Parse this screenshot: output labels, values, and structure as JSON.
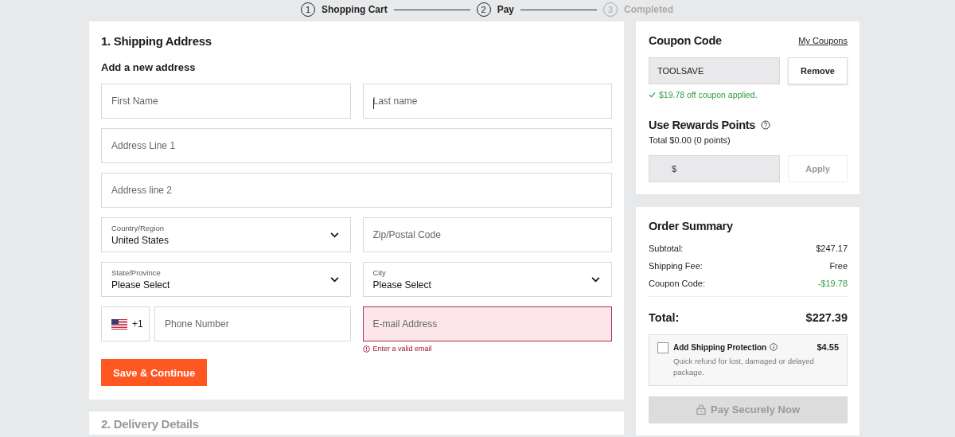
{
  "stepper": [
    {
      "number": "1",
      "label": "Shopping Cart",
      "active": true
    },
    {
      "number": "2",
      "label": "Pay",
      "active": true
    },
    {
      "number": "3",
      "label": "Completed",
      "active": false
    }
  ],
  "shipping": {
    "title": "1. Shipping Address",
    "subtitle": "Add a new address",
    "rows": [
      [
        {
          "kind": "text",
          "placeholder": "First Name",
          "error": false
        },
        {
          "kind": "text",
          "placeholder": "Last name",
          "error": false,
          "focused": true
        }
      ],
      [
        {
          "kind": "text",
          "placeholder": "Address Line 1",
          "error": false
        }
      ],
      [
        {
          "kind": "text",
          "placeholder": "Address line 2",
          "error": false
        }
      ],
      [
        {
          "kind": "select",
          "label": "Country/Region",
          "value": "United States"
        },
        {
          "kind": "text",
          "placeholder": "Zip/Postal Code",
          "error": false
        }
      ],
      [
        {
          "kind": "select",
          "label": "State/Province",
          "value": "Please Select"
        },
        {
          "kind": "select",
          "label": "City",
          "value": "Please Select"
        }
      ],
      [
        {
          "kind": "phone",
          "code": "+1",
          "placeholder": "Phone Number"
        },
        {
          "kind": "text",
          "placeholder": "E-mail Address",
          "error": true,
          "message": "Enter a valid email"
        }
      ]
    ],
    "button": "Save & Continue"
  },
  "next_section": {
    "title": "2. Delivery Details"
  },
  "coupon": {
    "title": "Coupon Code",
    "link": "My Coupons",
    "value": "TOOLSAVE",
    "button": "Remove",
    "message": "$19.78 off coupon applied."
  },
  "rewards": {
    "title": "Use Rewards Points",
    "total": "Total $0.00 (0 points)",
    "placeholder": "$",
    "button": "Apply",
    "disabled": true
  },
  "summary": {
    "title": "Order Summary",
    "lines": [
      {
        "label": "Subtotal:",
        "value": "$247.17",
        "discount": false
      },
      {
        "label": "Shipping Fee:",
        "value": "Free",
        "discount": false
      },
      {
        "label": "Coupon Code:",
        "value": "-$19.78",
        "discount": true
      }
    ],
    "total_label": "Total:",
    "total": "$227.39",
    "protection": {
      "title": "Add Shipping Protection",
      "price": "$4.55",
      "description": "Quick refund for lost, damaged or delayed package.",
      "checked": false
    },
    "pay_button": "Pay Securely Now",
    "pay_disabled": true
  }
}
